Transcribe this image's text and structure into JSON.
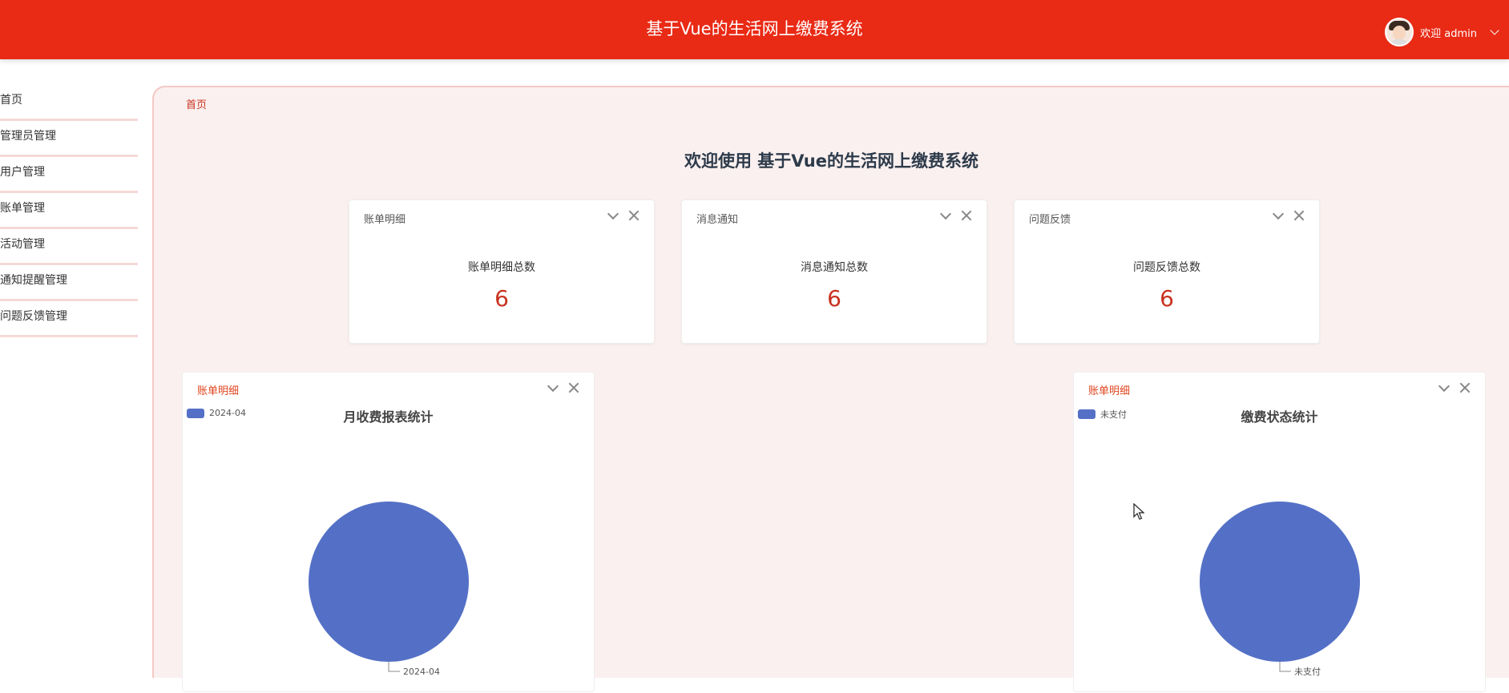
{
  "header": {
    "title": "基于Vue的生活网上缴费系统",
    "user_label": "欢迎 admin"
  },
  "sidebar": {
    "items": [
      {
        "label": "首页"
      },
      {
        "label": "管理员管理"
      },
      {
        "label": "用户管理"
      },
      {
        "label": "账单管理"
      },
      {
        "label": "活动管理"
      },
      {
        "label": "通知提醒管理"
      },
      {
        "label": "问题反馈管理"
      }
    ]
  },
  "breadcrumb": "首页",
  "welcome": "欢迎使用 基于Vue的生活网上缴费系统",
  "stat_cards": [
    {
      "title": "账单明细",
      "label": "账单明细总数",
      "value": "6"
    },
    {
      "title": "消息通知",
      "label": "消息通知总数",
      "value": "6"
    },
    {
      "title": "问题反馈",
      "label": "问题反馈总数",
      "value": "6"
    }
  ],
  "chart_cards": [
    {
      "title": "账单明细"
    },
    {
      "title": "账单明细"
    }
  ],
  "chart_data": [
    {
      "type": "pie",
      "title": "月收费报表统计",
      "categories": [
        "2024-04"
      ],
      "values": [
        100
      ],
      "legend_position": "top-left",
      "colors": [
        "#5470c6"
      ]
    },
    {
      "type": "pie",
      "title": "缴费状态统计",
      "categories": [
        "未支付"
      ],
      "values": [
        100
      ],
      "legend_position": "top-left",
      "colors": [
        "#5470c6"
      ]
    }
  ],
  "colors": {
    "header_bg": "#e92a15",
    "accent": "#c8321f",
    "pie": "#5470c6"
  },
  "icons": {
    "collapse": "chevron-down-icon",
    "close": "close-icon",
    "user_menu": "chevron-down-icon"
  }
}
